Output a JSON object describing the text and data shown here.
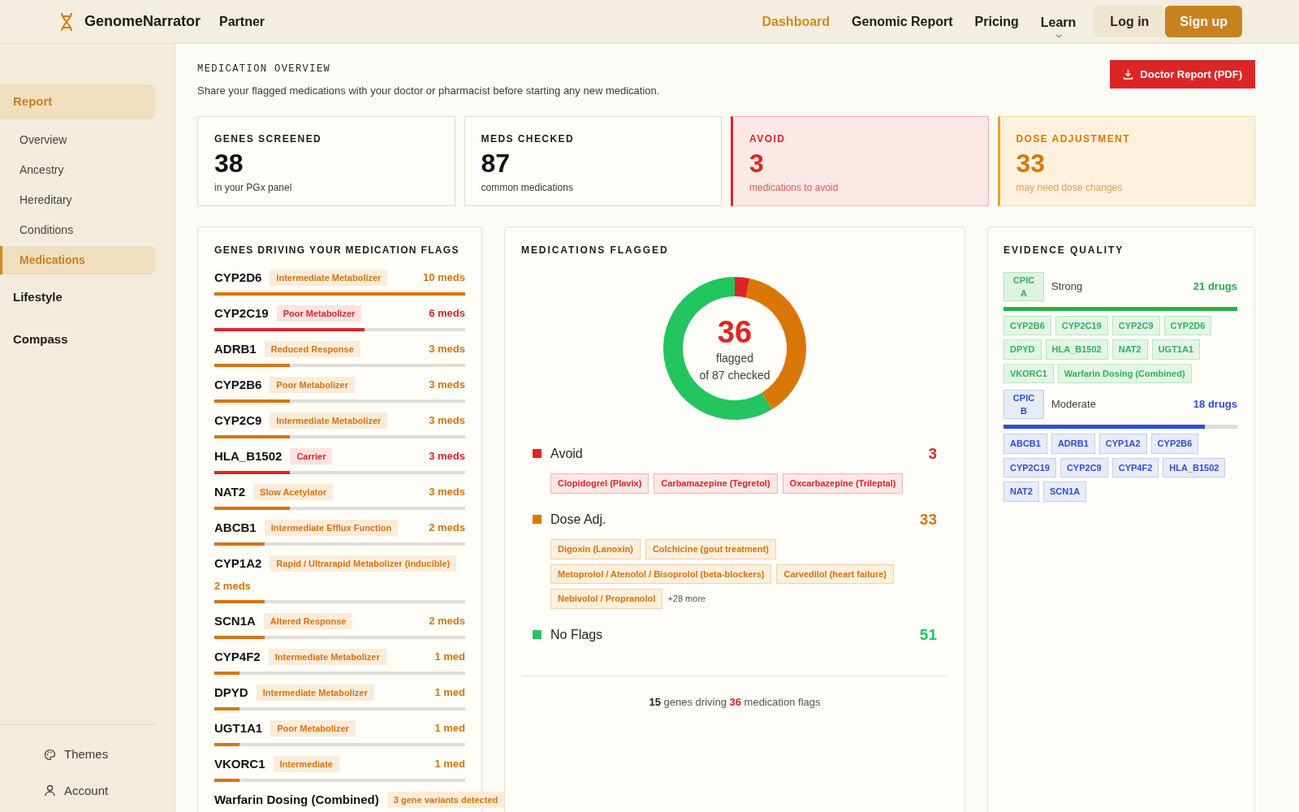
{
  "nav": {
    "brand": "GenomeNarrator",
    "partner": "Partner",
    "links": [
      {
        "label": "Dashboard",
        "selected": true
      },
      {
        "label": "Genomic Report",
        "selected": false
      },
      {
        "label": "Pricing",
        "selected": false
      },
      {
        "label": "Learn",
        "selected": false,
        "dropdown": true
      }
    ],
    "login": "Log in",
    "signup": "Sign up"
  },
  "sidebar": {
    "sections": [
      {
        "label": "Report",
        "selected": true,
        "children": [
          {
            "label": "Overview",
            "selected": false
          },
          {
            "label": "Ancestry",
            "selected": false
          },
          {
            "label": "Hereditary",
            "selected": false
          },
          {
            "label": "Conditions",
            "selected": false
          },
          {
            "label": "Medications",
            "selected": true
          }
        ]
      },
      {
        "label": "Lifestyle",
        "selected": false
      },
      {
        "label": "Compass",
        "selected": false
      }
    ],
    "footer": [
      {
        "label": "Themes",
        "kind": "themes"
      },
      {
        "label": "Account",
        "kind": "account"
      }
    ]
  },
  "overview": {
    "eyebrow": "MEDICATION OVERVIEW",
    "subtitle": "Share your flagged medications with your doctor or pharmacist before starting any new medication.",
    "button": "Doctor Report (PDF)"
  },
  "stats": [
    {
      "label": "GENES SCREENED",
      "value": "38",
      "caption": "in your PGx panel",
      "kind": "neutral"
    },
    {
      "label": "MEDS CHECKED",
      "value": "87",
      "caption": "common medications",
      "kind": "neutral"
    },
    {
      "label": "AVOID",
      "value": "3",
      "caption": "medications to avoid",
      "kind": "avoid"
    },
    {
      "label": "DOSE ADJUSTMENT",
      "value": "33",
      "caption": "may need dose changes",
      "kind": "dose"
    }
  ],
  "genes_panel": {
    "title": "GENES DRIVING YOUR MEDICATION FLAGS",
    "genes": [
      {
        "name": "CYP2D6",
        "phenotype": "Intermediate Metabolizer",
        "count": "10 meds",
        "level": 1,
        "kind": "dose"
      },
      {
        "name": "CYP2C19",
        "phenotype": "Poor Metabolizer",
        "count": "6 meds",
        "level": 0.6,
        "kind": "avoid"
      },
      {
        "name": "ADRB1",
        "phenotype": "Reduced Response",
        "count": "3 meds",
        "level": 0.3,
        "kind": "dose"
      },
      {
        "name": "CYP2B6",
        "phenotype": "Poor Metabolizer",
        "count": "3 meds",
        "level": 0.3,
        "kind": "dose"
      },
      {
        "name": "CYP2C9",
        "phenotype": "Intermediate Metabolizer",
        "count": "3 meds",
        "level": 0.3,
        "kind": "dose"
      },
      {
        "name": "HLA_B1502",
        "phenotype": "Carrier",
        "count": "3 meds",
        "level": 0.3,
        "kind": "avoid"
      },
      {
        "name": "NAT2",
        "phenotype": "Slow Acetylator",
        "count": "3 meds",
        "level": 0.3,
        "kind": "dose"
      },
      {
        "name": "ABCB1",
        "phenotype": "Intermediate Efflux Function",
        "count": "2 meds",
        "level": 0.2,
        "kind": "dose"
      },
      {
        "name": "CYP1A2",
        "phenotype": "Rapid / Ultrarapid Metabolizer (inducible)",
        "count": "2 meds",
        "level": 0.2,
        "kind": "dose"
      },
      {
        "name": "SCN1A",
        "phenotype": "Altered Response",
        "count": "2 meds",
        "level": 0.2,
        "kind": "dose"
      },
      {
        "name": "CYP4F2",
        "phenotype": "Intermediate Metabolizer",
        "count": "1 med",
        "level": 0.1,
        "kind": "dose"
      },
      {
        "name": "DPYD",
        "phenotype": "Intermediate Metabolizer",
        "count": "1 med",
        "level": 0.1,
        "kind": "dose"
      },
      {
        "name": "UGT1A1",
        "phenotype": "Poor Metabolizer",
        "count": "1 med",
        "level": 0.1,
        "kind": "dose"
      },
      {
        "name": "VKORC1",
        "phenotype": "Intermediate",
        "count": "1 med",
        "level": 0.1,
        "kind": "dose"
      },
      {
        "name": "Warfarin Dosing (Combined)",
        "phenotype": "3 gene variants detected",
        "kind": "dose"
      }
    ]
  },
  "meds_panel": {
    "title": "MEDICATIONS FLAGGED",
    "chart_data": {
      "type": "donut",
      "categories": [
        "Avoid",
        "Dose Adj.",
        "No Flags"
      ],
      "values": [
        3.4,
        37.9,
        58.7
      ]
    },
    "center_value": "36",
    "center_label": "flagged",
    "center_sub": "of 87 checked",
    "groups": [
      {
        "count": "3",
        "color": "#dc2626",
        "kind": "avoid",
        "meds": [
          "Clopidogrel (Plavix)",
          "Carbamazepine (Tegretol)",
          "Oxcarbazepine (Trileptal)"
        ]
      },
      {
        "count": "33",
        "color": "#d97706",
        "kind": "dose",
        "meds": [
          "Digoxin (Lanoxin)",
          "Colchicine (gout treatment)",
          "Metoprolol / Atenolol / Bisoprolol (beta-blockers)",
          "Carvedilol (heart failure)",
          "Nebivolol / Propranolol"
        ],
        "more": "+28 more"
      },
      {
        "count": "51",
        "color": "#22c55e",
        "kind": "none"
      }
    ],
    "footer": "**15** genes driving **36** medication flags"
  },
  "evidence": {
    "title": "EVIDENCE QUALITY",
    "tiers": [
      {
        "grade": "CPIC A",
        "label": "Strong",
        "count": "21 drugs",
        "level": 1,
        "kind": "strong",
        "genes": [
          "CYP2B6",
          "CYP2C19",
          "CYP2C9",
          "CYP2D6",
          "DPYD",
          "HLA_B1502",
          "NAT2",
          "UGT1A1",
          "VKORC1",
          "Warfarin Dosing (Combined)"
        ]
      },
      {
        "grade": "CPIC B",
        "label": "Moderate",
        "count": "18 drugs",
        "level": 0.86,
        "kind": "moderate",
        "genes": [
          "ABCB1",
          "ADRB1",
          "CYP1A2",
          "CYP2B6",
          "CYP2C19",
          "CYP2C9",
          "CYP4F2",
          "HLA_B1502",
          "NAT2",
          "SCN1A"
        ]
      }
    ]
  }
}
